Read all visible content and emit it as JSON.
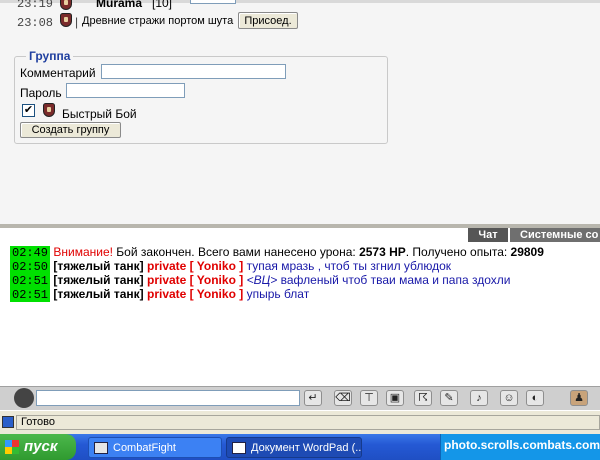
{
  "top_panel": {
    "battle_rows": [
      {
        "time": "23:19",
        "name": "Murama",
        "level": "[10]"
      },
      {
        "time": "23:08",
        "title": "Древние стражи портом шута",
        "join_label": "Присоед."
      }
    ],
    "group": {
      "legend": "Группа",
      "comment_label": "Комментарий",
      "comment_value": "",
      "password_label": "Пароль",
      "password_value": "",
      "quick_fight_checked": true,
      "quick_fight_label": "Быстрый Бой",
      "create_label": "Создать группу"
    }
  },
  "chat": {
    "tabs": [
      {
        "label": "Чат",
        "active": true
      },
      {
        "label": "Системные со",
        "active": false
      }
    ],
    "messages": [
      {
        "time": "02:49",
        "alert": "Внимание!",
        "text_1": " Бой закончен. Всего вами нанесено урона: ",
        "damage": "2573 HP",
        "text_2": ". Получено опыта: ",
        "exp": "29809"
      },
      {
        "time": "02:50",
        "nick": "[тяжелый танк]",
        "private": "private [ Yoniko ]",
        "msg": " тупая мразь , чтоб ты згнил ублюдок"
      },
      {
        "time": "02:51",
        "nick": "[тяжелый танк]",
        "private": "private [ Yoniko ]",
        "tag": " <ВЦ>",
        "msg": " вафленый чтоб тваи мама и папа здохли"
      },
      {
        "time": "02:51",
        "nick": "[тяжелый танк]",
        "private": "private [ Yoniko ]",
        "msg": " упырь блат"
      }
    ],
    "input_value": ""
  },
  "status": {
    "text": "Готово"
  },
  "taskbar": {
    "start_label": "пуск",
    "tasks": [
      {
        "label": "CombatFight"
      },
      {
        "label": "Документ WordPad (..."
      }
    ],
    "watermark": "photo.scrolls.combats.com"
  },
  "colors": {
    "timestamp_bg": "#00e000",
    "alert": "#e00000",
    "message": "#1818a8",
    "legend": "#1f3f9f"
  }
}
